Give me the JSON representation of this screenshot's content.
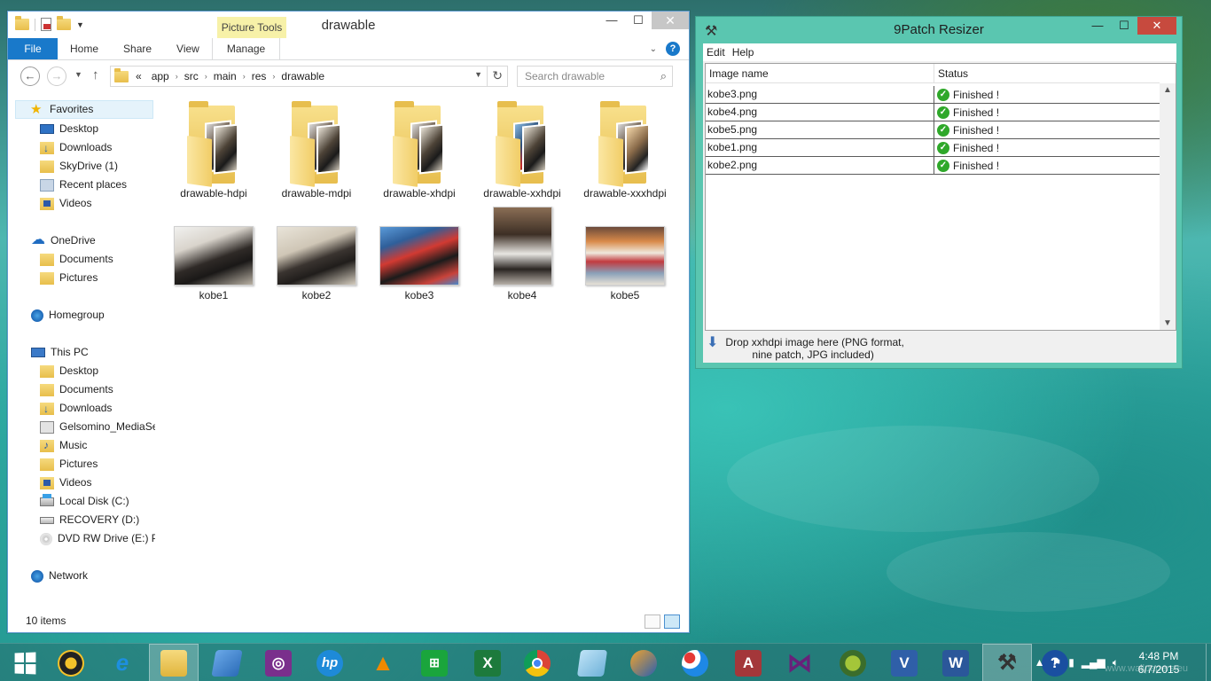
{
  "explorer": {
    "title": "drawable",
    "context_tab": "Picture Tools",
    "ribbon_tabs": [
      "File",
      "Home",
      "Share",
      "View",
      "Manage"
    ],
    "nav": {
      "back": "←",
      "forward": "→",
      "up": "↑",
      "breadcrumb": [
        "«",
        "app",
        "src",
        "main",
        "res",
        "drawable"
      ],
      "search_placeholder": "Search drawable"
    },
    "nav_pane": {
      "favorites": {
        "label": "Favorites",
        "items": [
          "Desktop",
          "Downloads",
          "SkyDrive (1)",
          "Recent places",
          "Videos"
        ]
      },
      "onedrive": {
        "label": "OneDrive",
        "items": [
          "Documents",
          "Pictures"
        ]
      },
      "homegroup": "Homegroup",
      "this_pc": {
        "label": "This PC",
        "items": [
          "Desktop",
          "Documents",
          "Downloads",
          "Gelsomino_MediaSe",
          "Music",
          "Pictures",
          "Videos",
          "Local Disk (C:)",
          "RECOVERY (D:)",
          "DVD RW Drive (E:) P/"
        ]
      },
      "network": "Network"
    },
    "folders": [
      "drawable-hdpi",
      "drawable-mdpi",
      "drawable-xhdpi",
      "drawable-xxhdpi",
      "drawable-xxxhdpi"
    ],
    "images": [
      "kobe1",
      "kobe2",
      "kobe3",
      "kobe4",
      "kobe5"
    ],
    "status": "10 items"
  },
  "resizer": {
    "title": "9Patch Resizer",
    "menu": [
      "Edit",
      "Help"
    ],
    "columns": [
      "Image name",
      "Status"
    ],
    "rows": [
      {
        "name": "kobe3.png",
        "status": "Finished !"
      },
      {
        "name": "kobe4.png",
        "status": "Finished !"
      },
      {
        "name": "kobe5.png",
        "status": "Finished !"
      },
      {
        "name": "kobe1.png",
        "status": "Finished !"
      },
      {
        "name": "kobe2.png",
        "status": "Finished !"
      }
    ],
    "drop_hint_line1": "Drop xxhdpi image here (PNG format,",
    "drop_hint_line2": "nine patch, JPG included)"
  },
  "taskbar": {
    "apps": [
      "start-button",
      "media-player",
      "internet-explorer",
      "file-explorer",
      "remote-app",
      "onenote-app",
      "hp-app",
      "vlc",
      "store",
      "excel",
      "chrome",
      "notepad",
      "video-editor",
      "paint",
      "access",
      "visual-studio",
      "android-studio",
      "visio",
      "word",
      "9patch-resizer",
      "help"
    ],
    "time": "4:48 PM",
    "date": "6/7/2015",
    "watermark": "www.wallpapers.eu"
  },
  "colors": {
    "file_tab": "#1979ca",
    "context_tab": "#f7f1a8",
    "resizer_frame": "#5ac6b0",
    "resizer_close": "#c74a3e",
    "check_green": "#2fa82a"
  }
}
